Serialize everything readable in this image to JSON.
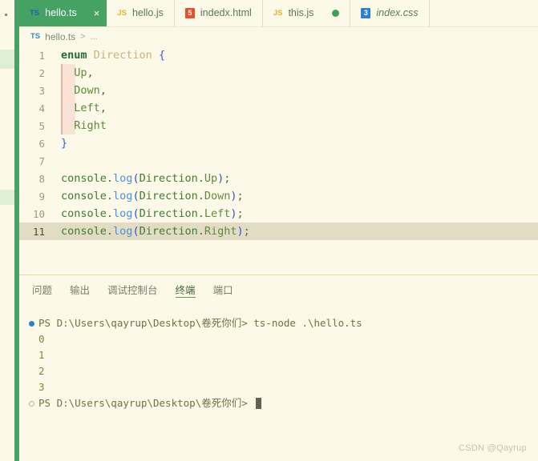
{
  "accent_color": "#46a263",
  "editor": {
    "background": "#fdf9e8",
    "current_line_color": "#e3dcc4",
    "breadcrumb": {
      "icon": "ts-icon",
      "file": "hello.ts",
      "separator": ">",
      "ellipsis": "..."
    },
    "lines": [
      {
        "no": "1",
        "segments": [
          {
            "t": "enum",
            "c": "t-kw"
          },
          {
            "t": " ",
            "c": "t-plain"
          },
          {
            "t": "Direction",
            "c": "t-type"
          },
          {
            "t": " ",
            "c": "t-plain"
          },
          {
            "t": "{",
            "c": "t-brace"
          }
        ]
      },
      {
        "no": "2",
        "indent": true,
        "segments": [
          {
            "t": "  ",
            "c": "t-plain"
          },
          {
            "t": "Up",
            "c": "t-member"
          },
          {
            "t": ",",
            "c": "t-punct"
          }
        ]
      },
      {
        "no": "3",
        "indent": true,
        "segments": [
          {
            "t": "  ",
            "c": "t-plain"
          },
          {
            "t": "Down",
            "c": "t-member"
          },
          {
            "t": ",",
            "c": "t-punct"
          }
        ]
      },
      {
        "no": "4",
        "indent": true,
        "segments": [
          {
            "t": "  ",
            "c": "t-plain"
          },
          {
            "t": "Left",
            "c": "t-member"
          },
          {
            "t": ",",
            "c": "t-punct"
          }
        ]
      },
      {
        "no": "5",
        "indent": true,
        "segments": [
          {
            "t": "  ",
            "c": "t-plain"
          },
          {
            "t": "Right",
            "c": "t-member"
          }
        ]
      },
      {
        "no": "6",
        "segments": [
          {
            "t": "}",
            "c": "t-brace"
          }
        ]
      },
      {
        "no": "7",
        "segments": []
      },
      {
        "no": "8",
        "segments": [
          {
            "t": "console",
            "c": "t-obj"
          },
          {
            "t": ".",
            "c": "t-punct"
          },
          {
            "t": "log",
            "c": "t-fn"
          },
          {
            "t": "(",
            "c": "t-paren"
          },
          {
            "t": "Direction",
            "c": "t-obj"
          },
          {
            "t": ".",
            "c": "t-punct"
          },
          {
            "t": "Up",
            "c": "t-prop"
          },
          {
            "t": ")",
            "c": "t-paren"
          },
          {
            "t": ";",
            "c": "t-punct"
          }
        ]
      },
      {
        "no": "9",
        "segments": [
          {
            "t": "console",
            "c": "t-obj"
          },
          {
            "t": ".",
            "c": "t-punct"
          },
          {
            "t": "log",
            "c": "t-fn"
          },
          {
            "t": "(",
            "c": "t-paren"
          },
          {
            "t": "Direction",
            "c": "t-obj"
          },
          {
            "t": ".",
            "c": "t-punct"
          },
          {
            "t": "Down",
            "c": "t-prop"
          },
          {
            "t": ")",
            "c": "t-paren"
          },
          {
            "t": ";",
            "c": "t-punct"
          }
        ]
      },
      {
        "no": "10",
        "segments": [
          {
            "t": "console",
            "c": "t-obj"
          },
          {
            "t": ".",
            "c": "t-punct"
          },
          {
            "t": "log",
            "c": "t-fn"
          },
          {
            "t": "(",
            "c": "t-paren"
          },
          {
            "t": "Direction",
            "c": "t-obj"
          },
          {
            "t": ".",
            "c": "t-punct"
          },
          {
            "t": "Left",
            "c": "t-prop"
          },
          {
            "t": ")",
            "c": "t-paren"
          },
          {
            "t": ";",
            "c": "t-punct"
          }
        ]
      },
      {
        "no": "11",
        "current": true,
        "segments": [
          {
            "t": "console",
            "c": "t-obj"
          },
          {
            "t": ".",
            "c": "t-punct"
          },
          {
            "t": "log",
            "c": "t-fn"
          },
          {
            "t": "(",
            "c": "t-paren"
          },
          {
            "t": "Direction",
            "c": "t-obj"
          },
          {
            "t": ".",
            "c": "t-punct"
          },
          {
            "t": "Right",
            "c": "t-prop"
          },
          {
            "t": ")",
            "c": "t-paren"
          },
          {
            "t": ";",
            "c": "t-punct"
          }
        ]
      }
    ]
  },
  "tabs": [
    {
      "label": "hello.ts",
      "icon": "ts-icon",
      "icon_text": "TS",
      "active": true,
      "close": "×",
      "dirty": false,
      "italic": false
    },
    {
      "label": "hello.js",
      "icon": "js-icon",
      "icon_text": "JS",
      "active": false,
      "dirty": false,
      "italic": false
    },
    {
      "label": "indedx.html",
      "icon": "html5-icon",
      "icon_text": "5",
      "active": false,
      "dirty": false,
      "italic": false
    },
    {
      "label": "this.js",
      "icon": "js-icon",
      "icon_text": "JS",
      "active": false,
      "dirty": true,
      "italic": false
    },
    {
      "label": "index.css",
      "icon": "css3-icon",
      "icon_text": "3",
      "active": false,
      "dirty": false,
      "italic": true
    }
  ],
  "panel": {
    "tabs": [
      {
        "label": "问题",
        "active": false
      },
      {
        "label": "输出",
        "active": false
      },
      {
        "label": "调试控制台",
        "active": false
      },
      {
        "label": "终端",
        "active": true
      },
      {
        "label": "端口",
        "active": false
      }
    ],
    "terminal": {
      "lines": [
        {
          "marker": "run",
          "text": "PS D:\\Users\\qayrup\\Desktop\\卷死你们> ts-node .\\hello.ts",
          "kind": "cmd"
        },
        {
          "marker": "none",
          "text": "0",
          "kind": "out"
        },
        {
          "marker": "none",
          "text": "1",
          "kind": "out"
        },
        {
          "marker": "none",
          "text": "2",
          "kind": "out"
        },
        {
          "marker": "none",
          "text": "3",
          "kind": "out"
        },
        {
          "marker": "idle",
          "text": "PS D:\\Users\\qayrup\\Desktop\\卷死你们> ",
          "kind": "prompt",
          "cursor": true
        }
      ]
    }
  },
  "watermark": "CSDN @Qayrup"
}
